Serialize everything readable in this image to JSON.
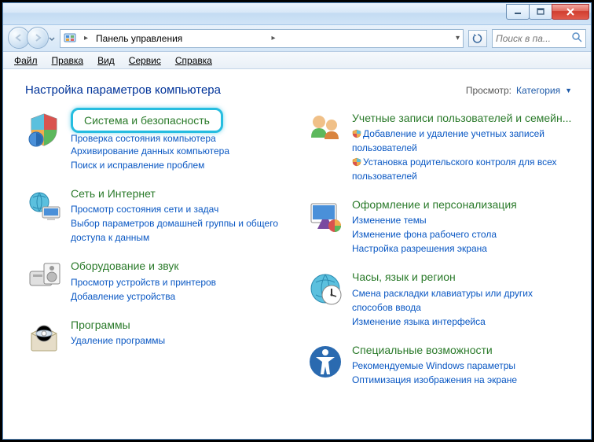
{
  "address": {
    "path": "Панель управления",
    "arrow": "▸"
  },
  "search": {
    "placeholder": "Поиск в па..."
  },
  "menubar": {
    "file": "Файл",
    "edit": "Правка",
    "view": "Вид",
    "service": "Сервис",
    "help": "Справка"
  },
  "page": {
    "title": "Настройка параметров компьютера",
    "view_label": "Просмотр:",
    "view_value": "Категория"
  },
  "left_col": [
    {
      "key": "system-security",
      "title": "Система и безопасность",
      "highlighted": true,
      "under_link": "Проверка состояния компьютера",
      "links": [
        {
          "text": "Архивирование данных компьютера"
        },
        {
          "text": "Поиск и исправление проблем"
        }
      ]
    },
    {
      "key": "network-internet",
      "title": "Сеть и Интернет",
      "links": [
        {
          "text": "Просмотр состояния сети и задач"
        },
        {
          "text": "Выбор параметров домашней группы и общего доступа к данным"
        }
      ]
    },
    {
      "key": "hardware-sound",
      "title": "Оборудование и звук",
      "links": [
        {
          "text": "Просмотр устройств и принтеров"
        },
        {
          "text": "Добавление устройства"
        }
      ]
    },
    {
      "key": "programs",
      "title": "Программы",
      "links": [
        {
          "text": "Удаление программы"
        }
      ]
    }
  ],
  "right_col": [
    {
      "key": "user-accounts",
      "title": "Учетные записи пользователей и семейн...",
      "links": [
        {
          "text": "Добавление и удаление учетных записей пользователей",
          "shield": true
        },
        {
          "text": "Установка родительского контроля для всех пользователей",
          "shield": true
        }
      ]
    },
    {
      "key": "appearance",
      "title": "Оформление и персонализация",
      "links": [
        {
          "text": "Изменение темы"
        },
        {
          "text": "Изменение фона рабочего стола"
        },
        {
          "text": "Настройка разрешения экрана"
        }
      ]
    },
    {
      "key": "clock-language",
      "title": "Часы, язык и регион",
      "links": [
        {
          "text": "Смена раскладки клавиатуры или других способов ввода"
        },
        {
          "text": "Изменение языка интерфейса"
        }
      ]
    },
    {
      "key": "ease-of-access",
      "title": "Специальные возможности",
      "links": [
        {
          "text": "Рекомендуемые Windows параметры"
        },
        {
          "text": "Оптимизация изображения на экране"
        }
      ]
    }
  ]
}
